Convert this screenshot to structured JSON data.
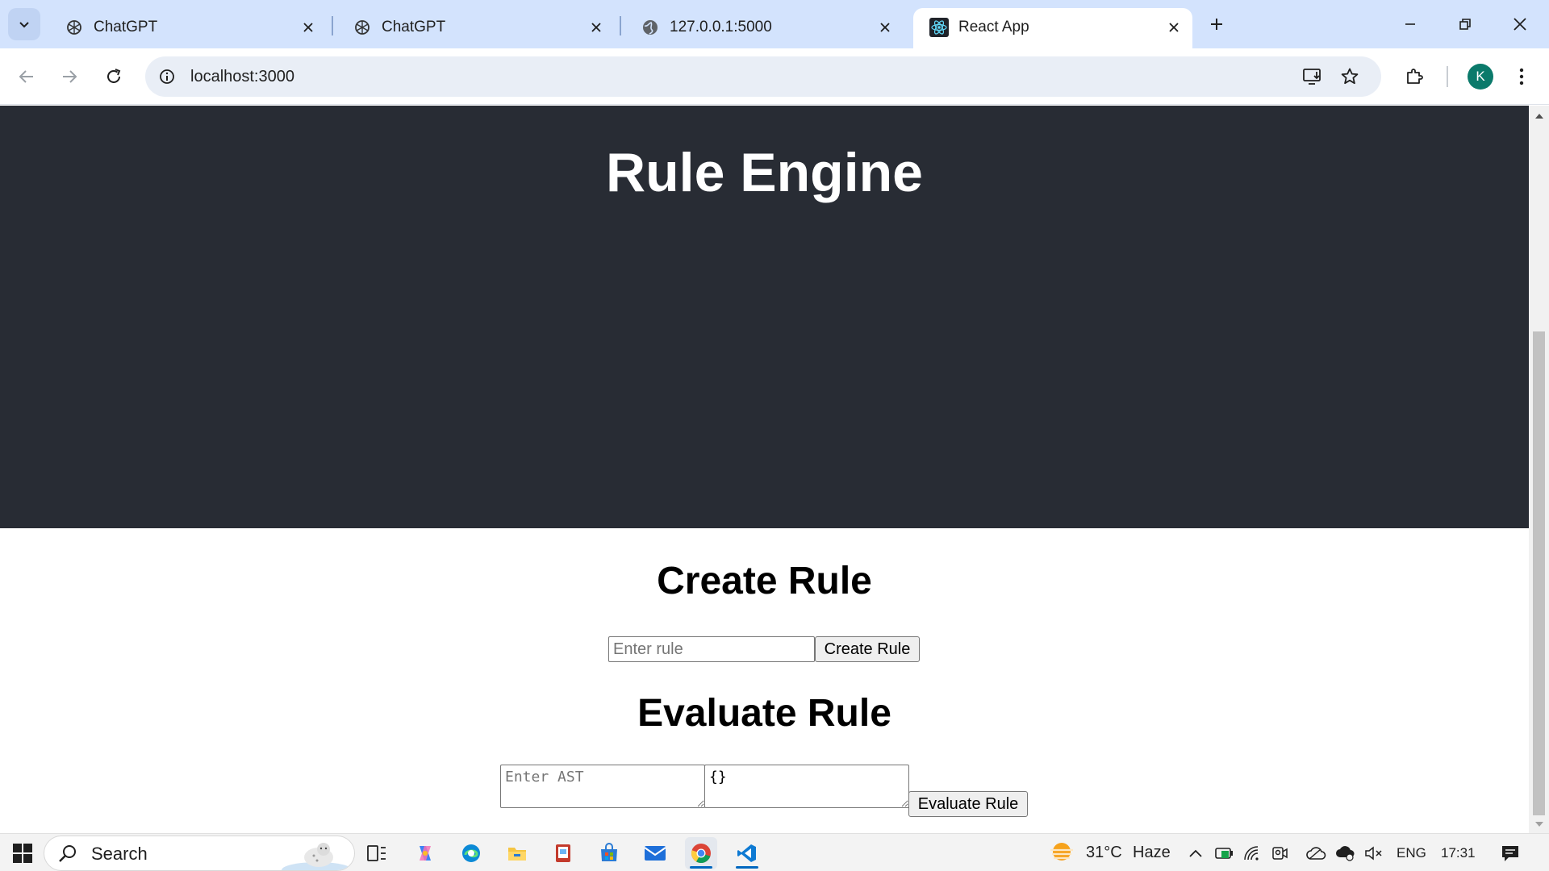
{
  "browser": {
    "tabs": [
      {
        "title": "ChatGPT",
        "icon": "openai-icon",
        "active": false
      },
      {
        "title": "ChatGPT",
        "icon": "openai-icon",
        "active": false
      },
      {
        "title": "127.0.0.1:5000",
        "icon": "globe-icon",
        "active": false
      },
      {
        "title": "React App",
        "icon": "react-icon",
        "active": true
      }
    ],
    "address": "localhost:3000",
    "profile_initial": "K"
  },
  "page": {
    "title": "Rule Engine",
    "create_section": {
      "heading": "Create Rule",
      "input_placeholder": "Enter rule",
      "input_value": "",
      "button_label": "Create Rule"
    },
    "evaluate_section": {
      "heading": "Evaluate Rule",
      "ast_placeholder": "Enter AST",
      "ast_value": "",
      "data_value": "{}",
      "button_label": "Evaluate Rule"
    }
  },
  "taskbar": {
    "search_label": "Search",
    "weather": {
      "temp": "31°C",
      "condition": "Haze"
    },
    "language": "ENG",
    "time": "17:31"
  },
  "colors": {
    "header_bg": "#282c34",
    "tabstrip_bg": "#d3e3fd",
    "omnibox_bg": "#e9eef6",
    "avatar_bg": "#0b7a6b"
  }
}
